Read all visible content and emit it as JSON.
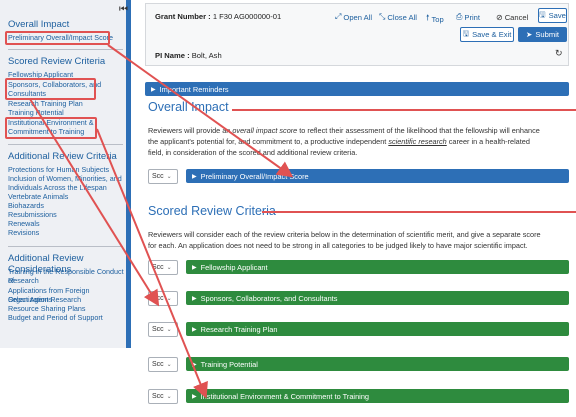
{
  "sidebar": {
    "overall_heading": "Overall Impact",
    "overall_links": [
      "Preliminary Overall/Impact Score"
    ],
    "scored_heading": "Scored Review Criteria",
    "scored_links": [
      "Fellowship Applicant",
      "Sponsors, Collaborators, and",
      "Consultants",
      "Research Training Plan",
      "Training Potential",
      "Institutional Environment &",
      "Commitment to Training"
    ],
    "additional_heading": "Additional Review Criteria",
    "additional_links": [
      "Protections for Human Subjects",
      "Inclusion of Women, Minorities, and",
      "Individuals Across the Lifespan",
      "Vertebrate Animals",
      "Biohazards",
      "Resubmissions",
      "Renewals",
      "Revisions"
    ],
    "considerations_heading": "Additional Review Considerations",
    "considerations_links": [
      "Training in the Responsible Conduct of",
      "Research",
      "Applications from Foreign Organizations",
      "Select Agent Research",
      "Resource Sharing Plans",
      "Budget and Period of Support"
    ]
  },
  "header": {
    "grant_label": "Grant Number :",
    "grant_value": "1 F30 AG000000-01",
    "pi_label": "PI Name :",
    "pi_value": "Bolt, Ash",
    "open_all": "Open All",
    "close_all": "Close All",
    "top": "Top",
    "print": "Print",
    "cancel": "Cancel",
    "save": "Save",
    "save_exit": "Save & Exit",
    "submit": "Submit"
  },
  "content": {
    "reminders": "Important Reminders",
    "overall_title": "Overall Impact",
    "overall_para_1": "Reviewers will provide an ",
    "overall_para_em": "overall impact score",
    "overall_para_2": " to reflect their assessment of the likelihood that the fellowship will enhance",
    "overall_para_line2": "the applicant's potential for, and commitment to, a productive independent ",
    "overall_para_link": "scientific research",
    "overall_para_3": " career in a health-related",
    "overall_para_line3": "field, in consideration of the scored and additional review criteria.",
    "score_placeholder": "Scc",
    "overall_bar": "Preliminary Overall/Impact Score",
    "scored_title": "Scored Review Criteria",
    "scored_para_line1": "Reviewers will consider each of the review criteria below in the determination of scientific merit, and give a separate score",
    "scored_para_line2": "for each. An application does not need to be strong in all categories to be judged likely to have major scientific impact.",
    "criteria": [
      "Fellowship Applicant",
      "Sponsors, Collaborators, and Consultants",
      "Research Training Plan",
      "Training Potential",
      "Institutional Environment & Commitment to Training"
    ]
  },
  "colors": {
    "accent_blue": "#2d6fb6",
    "accent_green": "#2e8b3e",
    "annotation_red": "#e05252"
  }
}
